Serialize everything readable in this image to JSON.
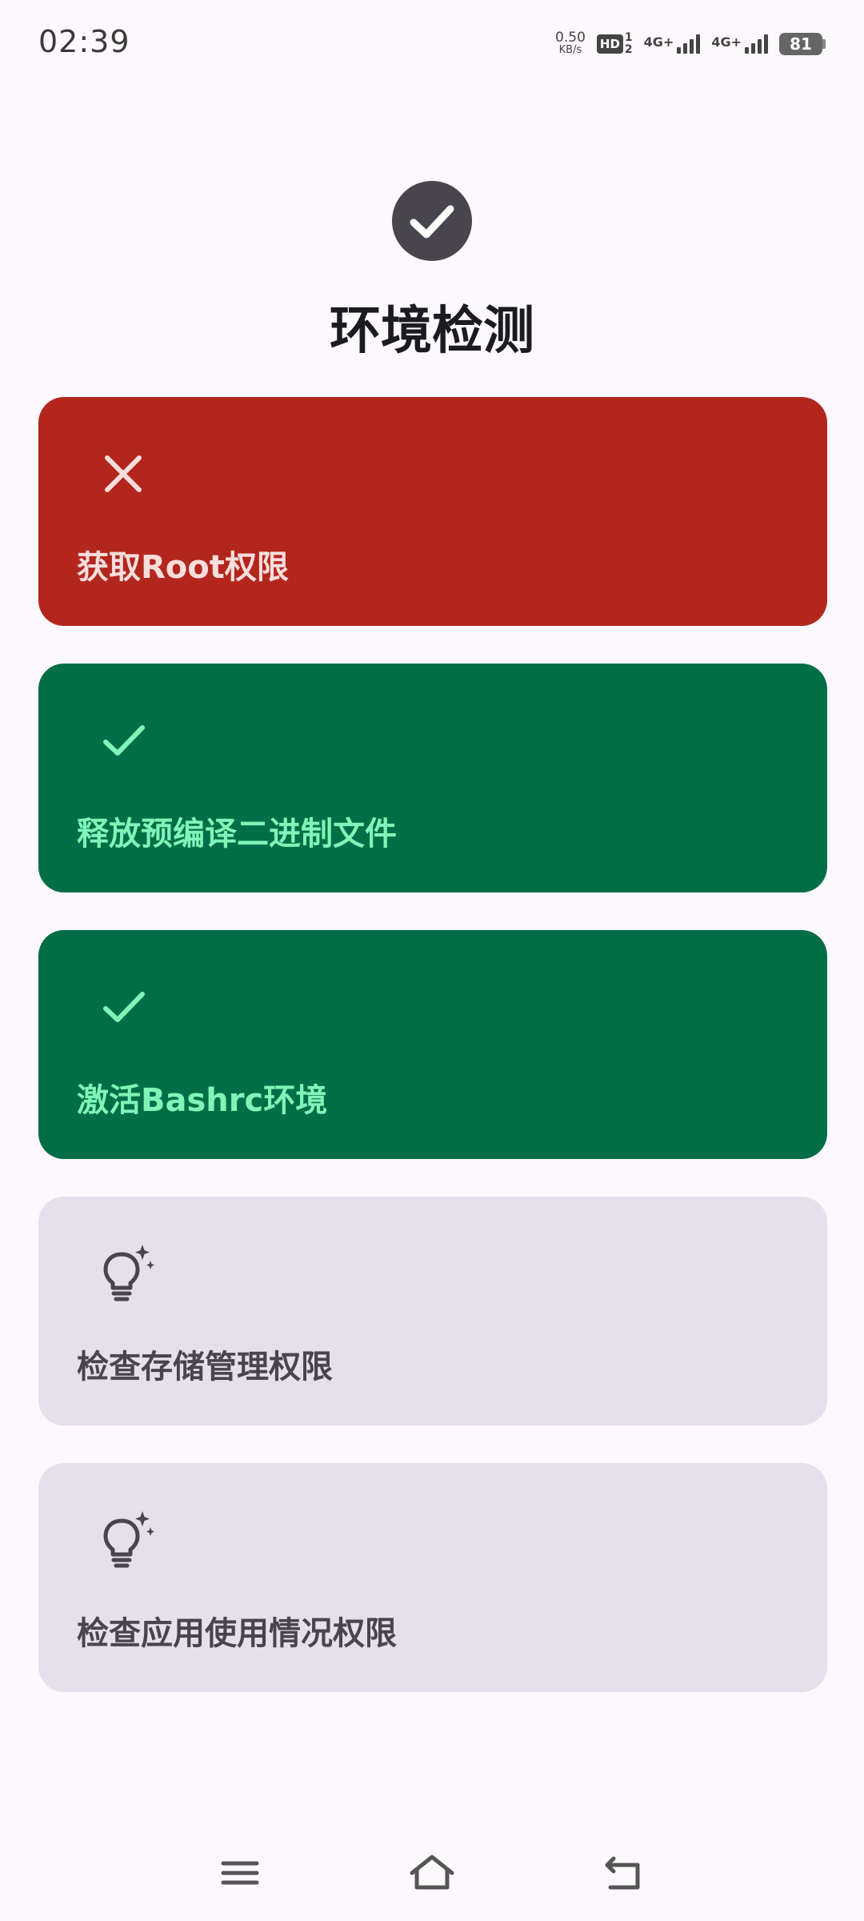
{
  "status_bar": {
    "time": "02:39",
    "net_speed_value": "0.50",
    "net_speed_unit": "KB/s",
    "hd_label": "HD",
    "hd_sim_top": "1",
    "hd_sim_bottom": "2",
    "signal1_label": "4G+",
    "signal2_label": "4G+",
    "battery_level": "81"
  },
  "header": {
    "title": "环境检测",
    "icon": "check-circle-icon"
  },
  "checks": [
    {
      "label": "获取Root权限",
      "status": "fail",
      "icon": "close-icon"
    },
    {
      "label": "释放预编译二进制文件",
      "status": "ok",
      "icon": "check-icon"
    },
    {
      "label": "激活Bashrc环境",
      "status": "ok",
      "icon": "check-icon"
    },
    {
      "label": "检查存储管理权限",
      "status": "pending",
      "icon": "lightbulb-sparkle-icon"
    },
    {
      "label": "检查应用使用情况权限",
      "status": "pending",
      "icon": "lightbulb-sparkle-icon"
    }
  ],
  "colors": {
    "fail_bg": "#b3261e",
    "ok_bg": "#026e47",
    "ok_fg": "#7ff5b8",
    "pending_bg": "#e6e0ec",
    "background": "#fdf8fd"
  },
  "nav": {
    "menu_icon": "menu-icon",
    "home_icon": "home-icon",
    "back_icon": "back-icon"
  }
}
